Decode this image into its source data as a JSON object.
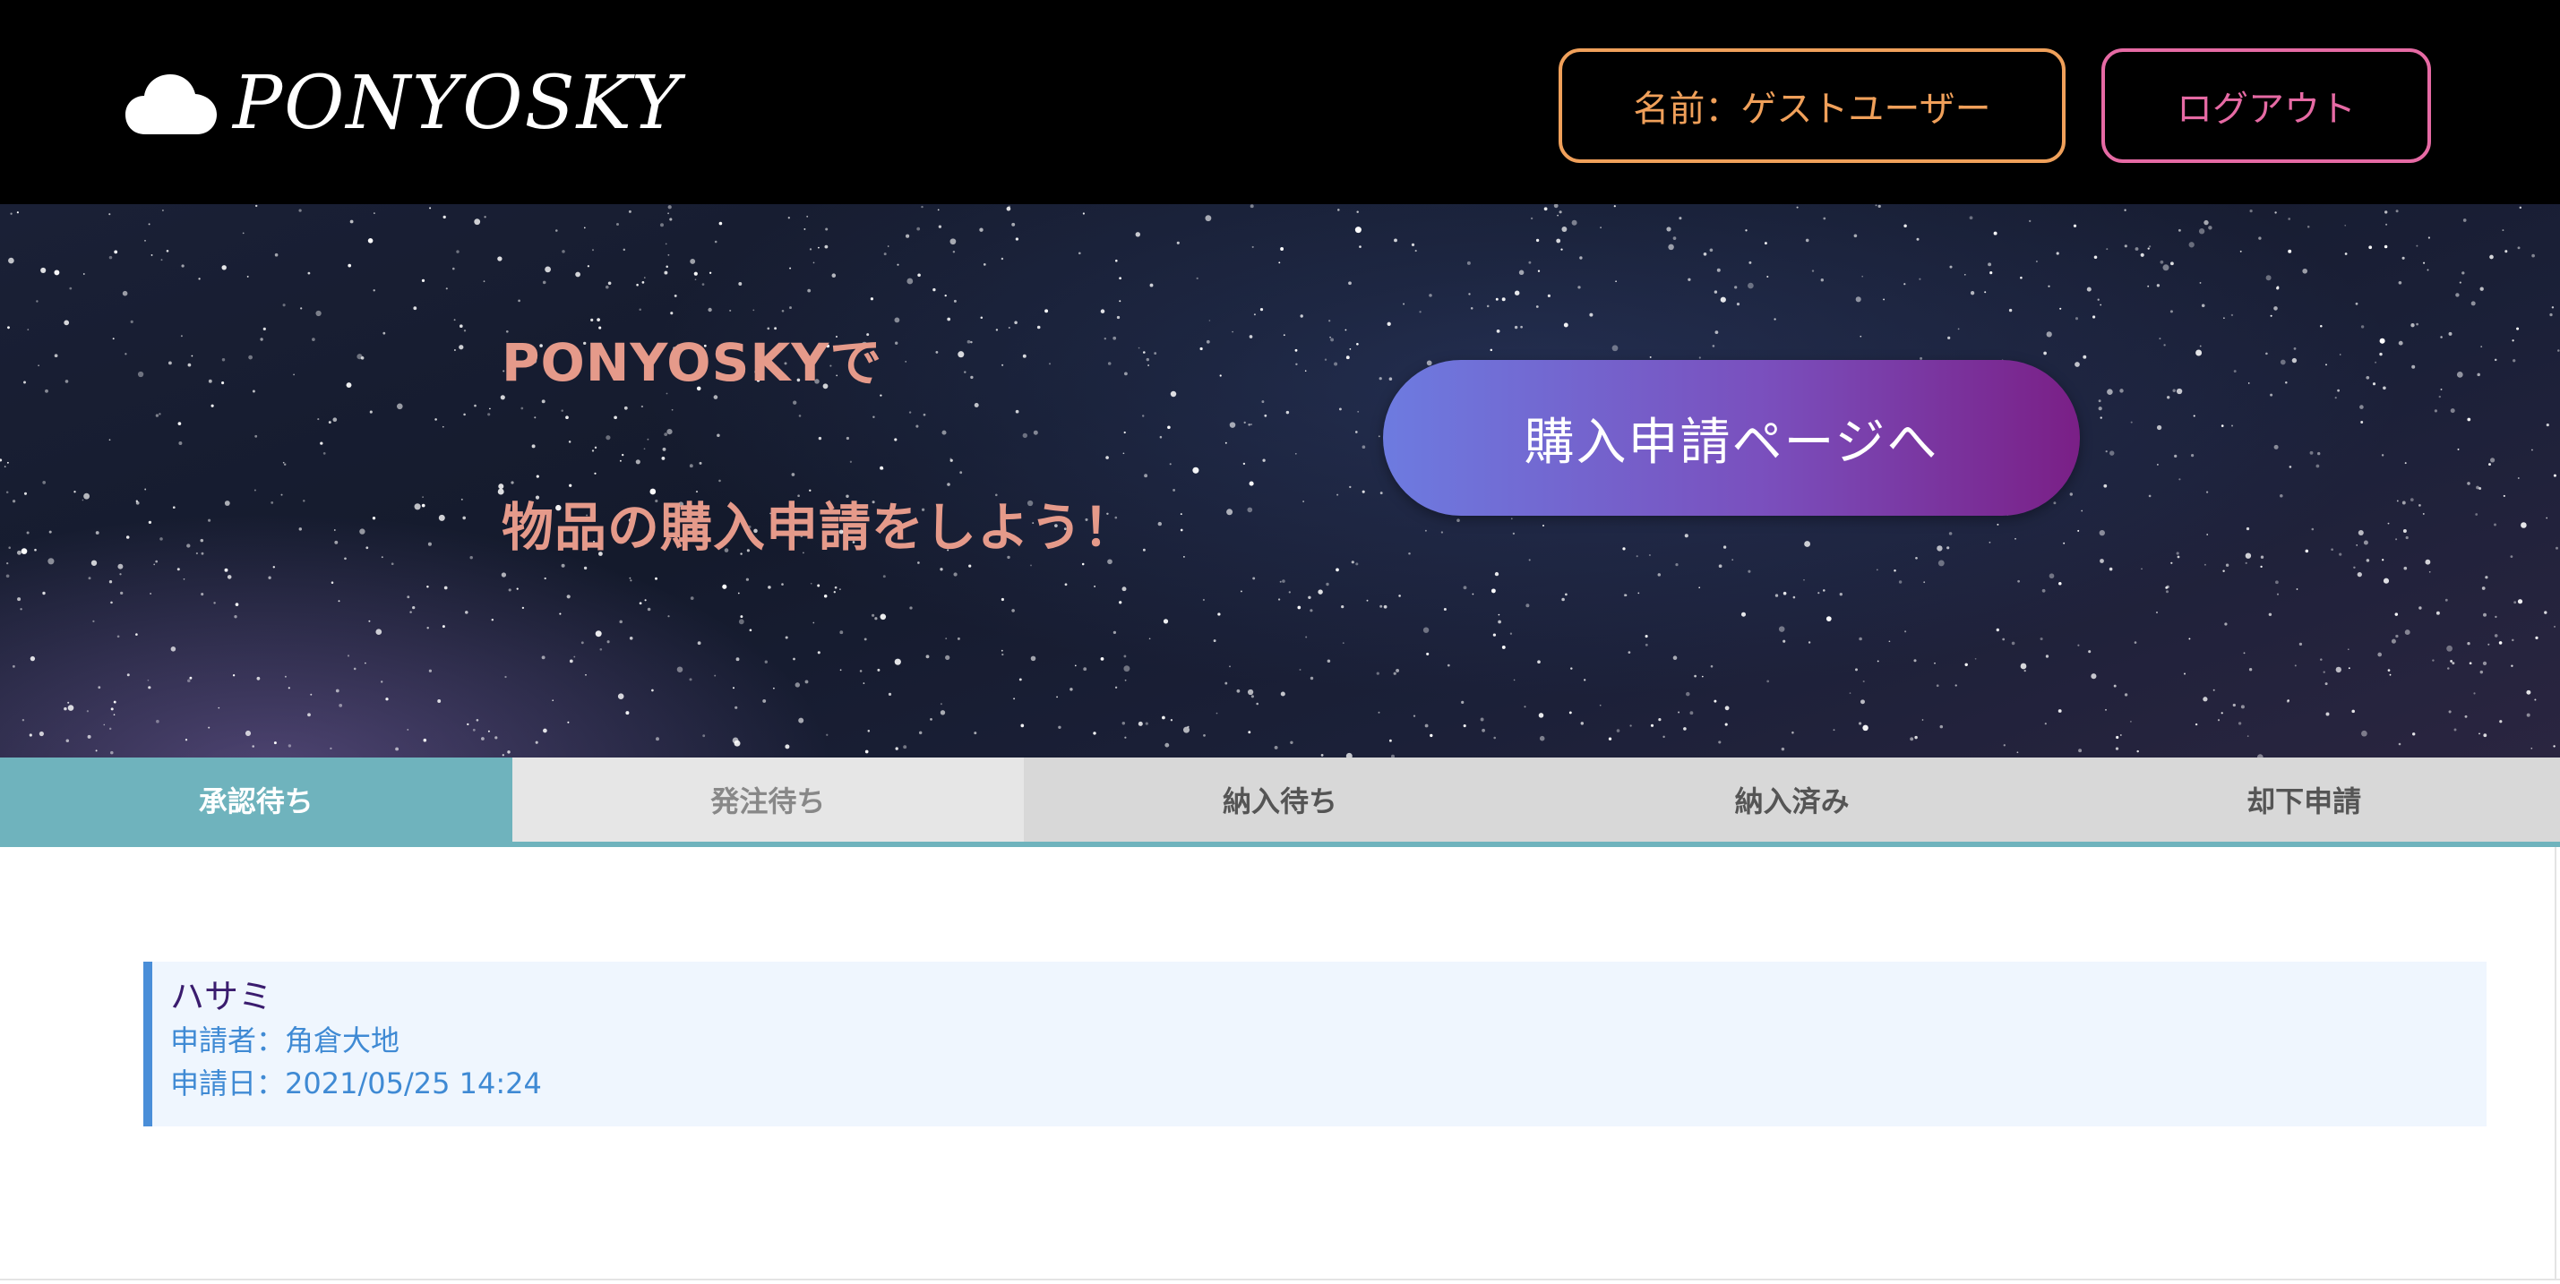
{
  "header": {
    "logo_text": "PONYOSKY",
    "logo_icon": "cloud-icon",
    "user_button_label": "名前：ゲストユーザー",
    "logout_button_label": "ログアウト",
    "colors": {
      "background": "#000000",
      "user_button": "#f0a05a",
      "logout_button": "#e66aa4"
    }
  },
  "hero": {
    "line1": "PONYOSKYで",
    "line2": "物品の購入申請をしよう！",
    "cta_label": "購入申請ページへ",
    "colors": {
      "text": "#e59a8a",
      "cta_gradient_start": "#6d7be0",
      "cta_gradient_end": "#7a1f86"
    }
  },
  "tabs": [
    {
      "label": "承認待ち",
      "state": "active"
    },
    {
      "label": "発注待ち",
      "state": "hover"
    },
    {
      "label": "納入待ち",
      "state": "default"
    },
    {
      "label": "納入済み",
      "state": "default"
    },
    {
      "label": "却下申請",
      "state": "default"
    }
  ],
  "requests": [
    {
      "item": "ハサミ",
      "applicant_line": "申請者：角倉大地",
      "date_line": "申請日：2021/05/25 14:24"
    }
  ],
  "colors": {
    "tab_active": "#6fb3bd",
    "tab_default": "#d8d8d8",
    "card_background": "#eff6fe",
    "card_accent": "#4a8ed8"
  }
}
